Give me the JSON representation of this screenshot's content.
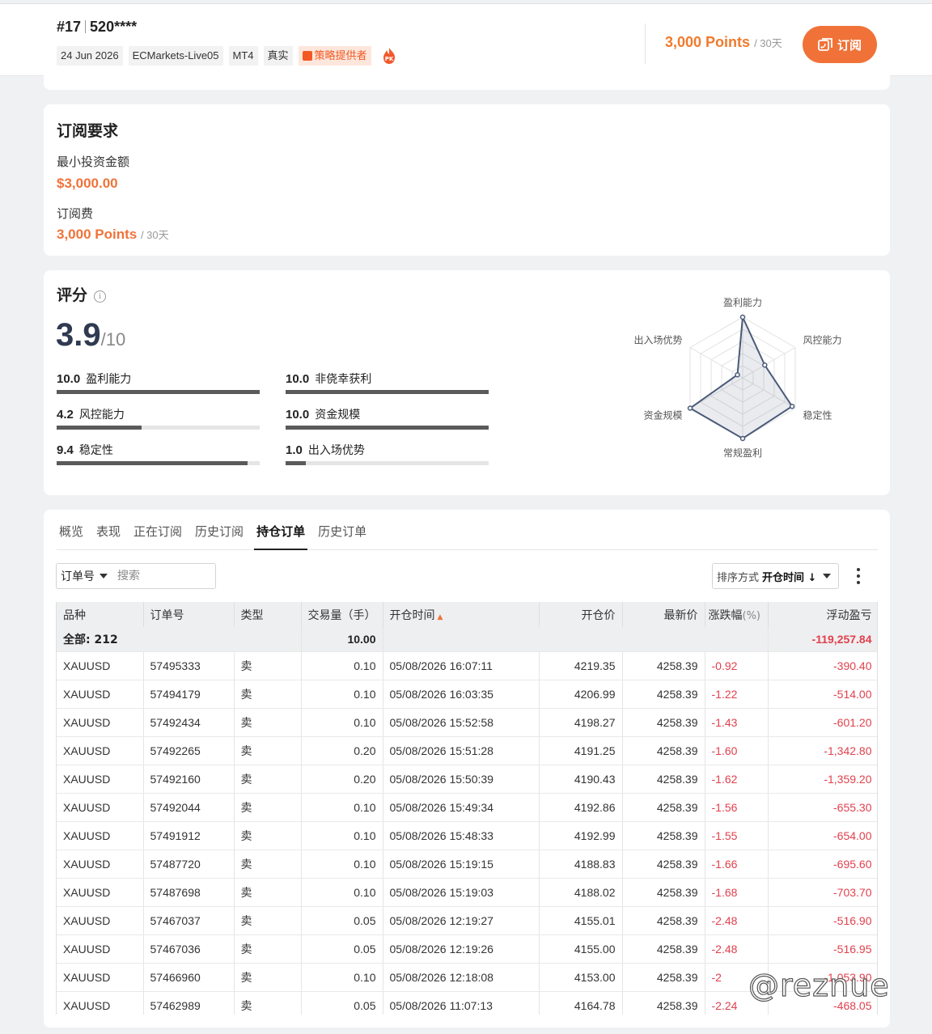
{
  "header": {
    "rank": "#17",
    "account": "520****",
    "tags": [
      "24 Jun 2026",
      "ECMarkets-Live05",
      "MT4",
      "真实"
    ],
    "provider_tag": "策略提供者",
    "price": "3,000 Points",
    "price_period": "/ 30天",
    "subscribe_label": "订阅"
  },
  "requirements": {
    "title": "订阅要求",
    "min_invest_label": "最小投资金额",
    "min_invest_value": "$3,000.00",
    "fee_label": "订阅费",
    "fee_value": "3,000 Points",
    "fee_period": "/ 30天"
  },
  "score": {
    "title": "评分",
    "value": "3.9",
    "max": "/10",
    "metrics": [
      {
        "value": "10.0",
        "label": "盈利能力",
        "fraction": 1.0
      },
      {
        "value": "10.0",
        "label": "非侥幸获利",
        "fraction": 1.0
      },
      {
        "value": "4.2",
        "label": "风控能力",
        "fraction": 0.42
      },
      {
        "value": "10.0",
        "label": "资金规模",
        "fraction": 1.0
      },
      {
        "value": "9.4",
        "label": "稳定性",
        "fraction": 0.94
      },
      {
        "value": "1.0",
        "label": "出入场优势",
        "fraction": 0.1
      }
    ],
    "radar_labels": [
      "盈利能力",
      "风控能力",
      "稳定性",
      "常规盈利",
      "资金规模",
      "出入场优势"
    ],
    "radar_values": [
      10.0,
      4.2,
      9.4,
      10.0,
      10.0,
      1.0
    ],
    "radar_max": 10,
    "radar_color": "#4a5a78"
  },
  "tabs": [
    "概览",
    "表现",
    "正在订阅",
    "历史订阅",
    "持仓订单",
    "历史订单"
  ],
  "active_tab": 4,
  "filter": {
    "select_label": "订单号",
    "search_placeholder": "搜索",
    "sort_prefix": "排序方式",
    "sort_value": "开仓时间 ↓"
  },
  "table": {
    "columns": [
      "品种",
      "订单号",
      "类型",
      "交易量（手）",
      "开仓时间",
      "开仓价",
      "最新价",
      "涨跌幅",
      "(%)",
      "浮动盈亏"
    ],
    "total": {
      "label": "全部: 212",
      "volume": "10.00",
      "pnl": "-119,257.84"
    },
    "rows": [
      [
        "XAUUSD",
        "57495333",
        "卖",
        "0.10",
        "05/08/2026 16:07:11",
        "4219.35",
        "4258.39",
        "-0.92",
        "-390.40"
      ],
      [
        "XAUUSD",
        "57494179",
        "卖",
        "0.10",
        "05/08/2026 16:03:35",
        "4206.99",
        "4258.39",
        "-1.22",
        "-514.00"
      ],
      [
        "XAUUSD",
        "57492434",
        "卖",
        "0.10",
        "05/08/2026 15:52:58",
        "4198.27",
        "4258.39",
        "-1.43",
        "-601.20"
      ],
      [
        "XAUUSD",
        "57492265",
        "卖",
        "0.20",
        "05/08/2026 15:51:28",
        "4191.25",
        "4258.39",
        "-1.60",
        "-1,342.80"
      ],
      [
        "XAUUSD",
        "57492160",
        "卖",
        "0.20",
        "05/08/2026 15:50:39",
        "4190.43",
        "4258.39",
        "-1.62",
        "-1,359.20"
      ],
      [
        "XAUUSD",
        "57492044",
        "卖",
        "0.10",
        "05/08/2026 15:49:34",
        "4192.86",
        "4258.39",
        "-1.56",
        "-655.30"
      ],
      [
        "XAUUSD",
        "57491912",
        "卖",
        "0.10",
        "05/08/2026 15:48:33",
        "4192.99",
        "4258.39",
        "-1.55",
        "-654.00"
      ],
      [
        "XAUUSD",
        "57487720",
        "卖",
        "0.10",
        "05/08/2026 15:19:15",
        "4188.83",
        "4258.39",
        "-1.66",
        "-695.60"
      ],
      [
        "XAUUSD",
        "57487698",
        "卖",
        "0.10",
        "05/08/2026 15:19:03",
        "4188.02",
        "4258.39",
        "-1.68",
        "-703.70"
      ],
      [
        "XAUUSD",
        "57467037",
        "卖",
        "0.05",
        "05/08/2026 12:19:27",
        "4155.01",
        "4258.39",
        "-2.48",
        "-516.90"
      ],
      [
        "XAUUSD",
        "57467036",
        "卖",
        "0.05",
        "05/08/2026 12:19:26",
        "4155.00",
        "4258.39",
        "-2.48",
        "-516.95"
      ],
      [
        "XAUUSD",
        "57466960",
        "卖",
        "0.10",
        "05/08/2026 12:18:08",
        "4153.00",
        "4258.39",
        "-2",
        "-1,053.90"
      ],
      [
        "XAUUSD",
        "57462989",
        "卖",
        "0.05",
        "05/08/2026 11:07:13",
        "4164.78",
        "4258.39",
        "-2.24",
        "-468.05"
      ]
    ]
  },
  "watermark": "@reznue"
}
